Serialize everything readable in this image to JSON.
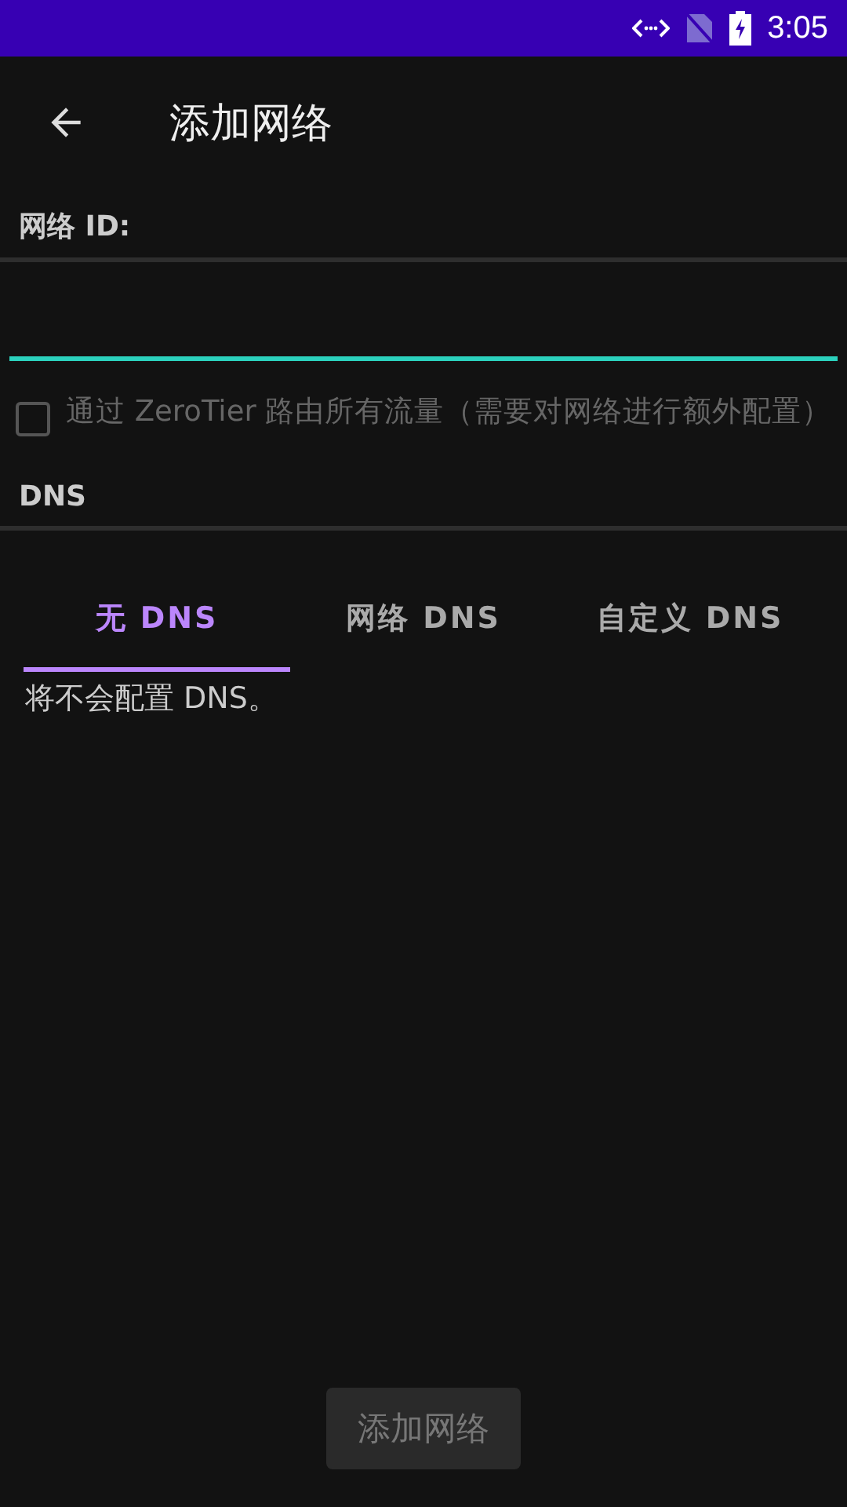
{
  "status_bar": {
    "time": "3:05"
  },
  "app_bar": {
    "title": "添加网络"
  },
  "network_id": {
    "label": "网络 ID:"
  },
  "route_all": {
    "label": "通过 ZeroTier 路由所有流量（需要对网络进行额外配置）",
    "checked": false,
    "disabled": true
  },
  "dns": {
    "label": "DNS",
    "tabs": [
      {
        "label": "无 DNS",
        "selected": true
      },
      {
        "label": "网络 DNS",
        "selected": false
      },
      {
        "label": "自定义 DNS",
        "selected": false
      }
    ],
    "description": "将不会配置 DNS。"
  },
  "submit": {
    "label": "添加网络",
    "disabled": true
  }
}
